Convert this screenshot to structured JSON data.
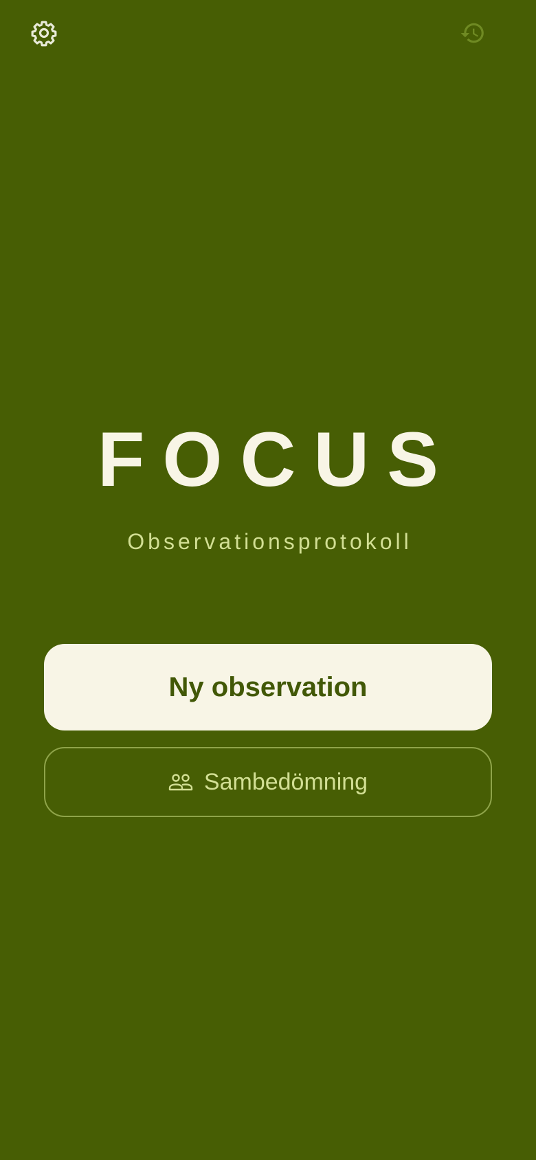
{
  "header": {
    "settings_icon": "gear-icon",
    "history_icon": "history-icon"
  },
  "hero": {
    "title": "FOCUS",
    "subtitle": "Observationsprotokoll"
  },
  "actions": {
    "primary_label": "Ny observation",
    "secondary_label": "Sambedömning",
    "secondary_icon": "people-icon"
  },
  "colors": {
    "background": "#475e04",
    "cream": "#f8f5e6",
    "light_green": "#d2df94",
    "dark_green_text": "#425807",
    "muted_icon": "#6f8a23",
    "button_border": "#8fa44a"
  }
}
